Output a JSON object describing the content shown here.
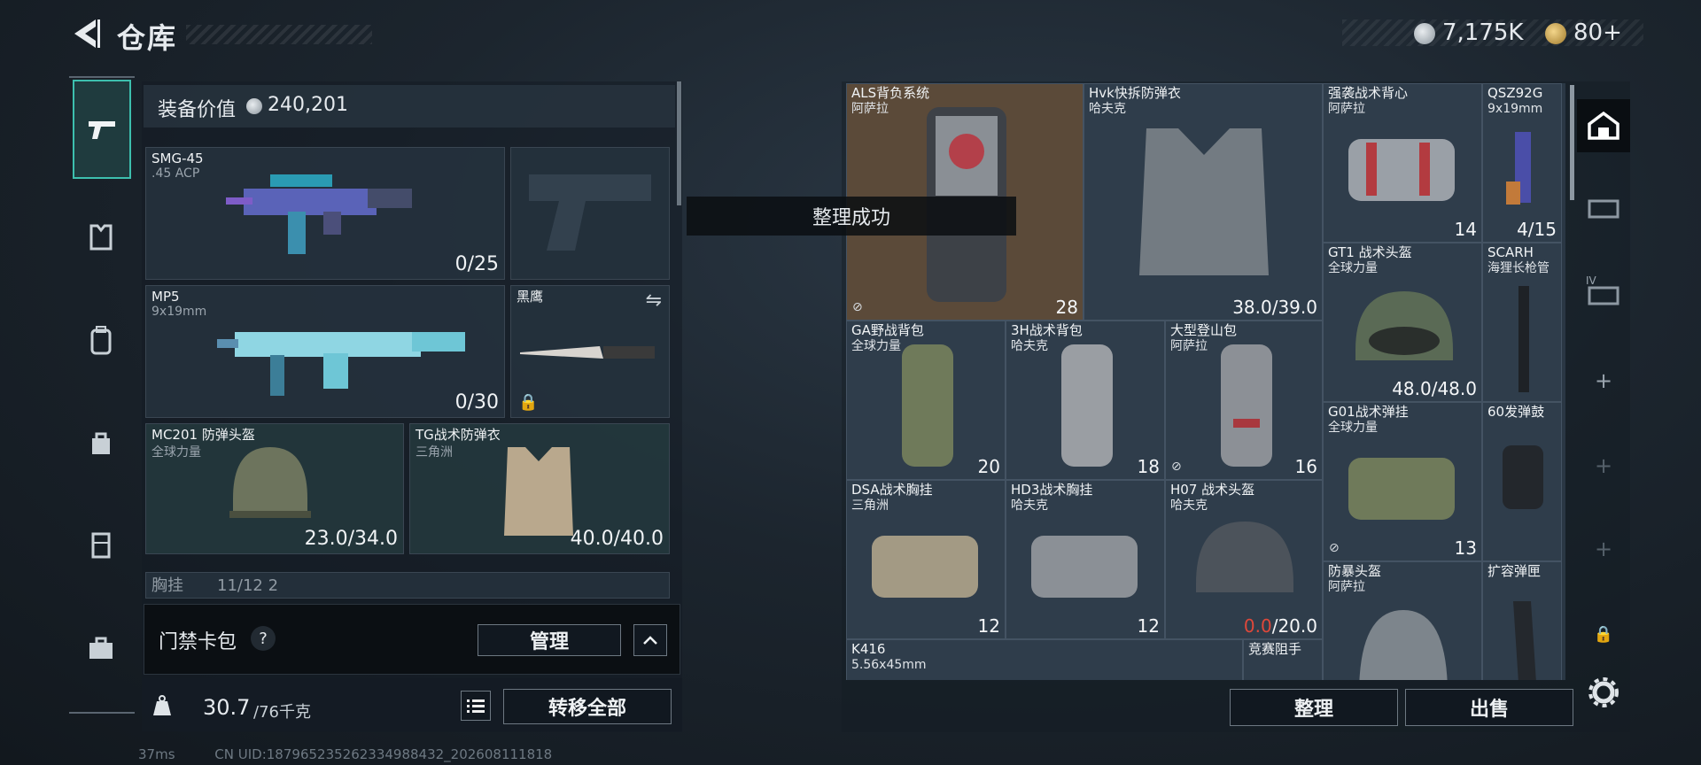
{
  "header": {
    "title": "仓库",
    "silver": "7,175K",
    "gold": "80+"
  },
  "equip_value": {
    "label": "装备价值",
    "value": "240,201"
  },
  "left_slots": [
    {
      "name": "SMG-45",
      "sub": ".45 ACP",
      "count": "0/25"
    },
    {
      "name": "MP5",
      "sub": "9x19mm",
      "count": "0/30"
    },
    {
      "name": "黑鹰",
      "sub": "",
      "count": ""
    },
    {
      "name": "MC201 防弹头盔",
      "sub": "全球力量",
      "count": "23.0/34.0"
    },
    {
      "name": "TG战术防弹衣",
      "sub": "三角洲",
      "count": "40.0/40.0"
    },
    {
      "name": "胸挂",
      "sub": "11/12 2",
      "count": ""
    }
  ],
  "access": {
    "label": "门禁卡包",
    "help": "?",
    "manage": "管理"
  },
  "weight": {
    "current": "30.7",
    "max": "/76千克",
    "transfer_all": "转移全部"
  },
  "toast": "整理成功",
  "grid": [
    {
      "name": "ALS背负系统",
      "sub": "阿萨拉",
      "count": "28"
    },
    {
      "name": "Hvk快拆防弹衣",
      "sub": "哈夫克",
      "count": "38.0/39.0"
    },
    {
      "name": "强袭战术背心",
      "sub": "阿萨拉",
      "count": "14"
    },
    {
      "name": "QSZ92G",
      "sub": "9x19mm",
      "count": "4/15"
    },
    {
      "name": "GT1 战术头盔",
      "sub": "全球力量",
      "count": "48.0/48.0"
    },
    {
      "name": "SCARH",
      "sub": "海狸长枪管",
      "count": ""
    },
    {
      "name": "GA野战背包",
      "sub": "全球力量",
      "count": "20"
    },
    {
      "name": "3H战术背包",
      "sub": "哈夫克",
      "count": "18"
    },
    {
      "name": "大型登山包",
      "sub": "阿萨拉",
      "count": "16"
    },
    {
      "name": "G01战术弹挂",
      "sub": "全球力量",
      "count": "13"
    },
    {
      "name": "60发弹鼓",
      "sub": "",
      "count": ""
    },
    {
      "name": "DSA战术胸挂",
      "sub": "三角洲",
      "count": "12"
    },
    {
      "name": "HD3战术胸挂",
      "sub": "哈夫克",
      "count": "12"
    },
    {
      "name": "H07 战术头盔",
      "sub": "哈夫克",
      "count_red": "0.0",
      "count": "/20.0"
    },
    {
      "name": "防暴头盔",
      "sub": "阿萨拉",
      "count": ""
    },
    {
      "name": "扩容弹匣",
      "sub": "",
      "count": ""
    },
    {
      "name": "K416",
      "sub": "5.56x45mm",
      "count": ""
    },
    {
      "name": "竞赛阻手",
      "sub": "",
      "count": ""
    }
  ],
  "actions": {
    "sort": "整理",
    "sell": "出售"
  },
  "right_tabs": [
    "IV"
  ],
  "status": {
    "ping": "37ms",
    "uid": "CN UID:187965235262334988432_202608111818"
  },
  "colors": {
    "accent_teal": "#3dbfae",
    "selected_cell": "#5b4a39",
    "durability_red": "#e0483a"
  }
}
